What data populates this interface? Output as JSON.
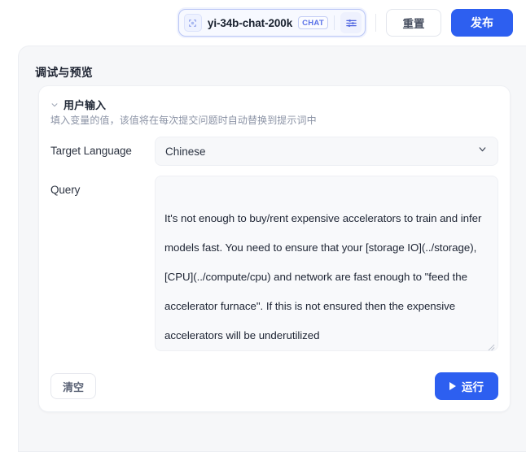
{
  "topbar": {
    "model": {
      "icon": "model-cube-icon",
      "name": "yi-34b-chat-200k",
      "badge": "CHAT",
      "params_icon": "sliders-icon"
    },
    "reset_label": "重置",
    "publish_label": "发布"
  },
  "panel": {
    "title": "调试与预览"
  },
  "section": {
    "collapse_icon": "chevron-down-icon",
    "title": "用户输入",
    "description": "填入变量的值，该值将在每次提交问题时自动替换到提示词中"
  },
  "fields": {
    "target_language": {
      "label": "Target Language",
      "value": "Chinese",
      "chevron_icon": "chevron-down-icon"
    },
    "query": {
      "label": "Query",
      "value": "It's not enough to buy/rent expensive accelerators to train and infer models fast. You need to ensure that your [storage IO](../storage), [CPU](../compute/cpu) and network are fast enough to \"feed the accelerator furnace\". If this is not ensured then the expensive accelerators will be underutilized",
      "placeholder": ""
    }
  },
  "footer": {
    "clear_label": "清空",
    "run_label": "运行",
    "run_icon": "play-icon"
  },
  "colors": {
    "primary": "#2d5ff0",
    "badge_text": "#5871e8",
    "panel_bg": "#f6f7f9",
    "field_bg": "#f8f9fb"
  }
}
